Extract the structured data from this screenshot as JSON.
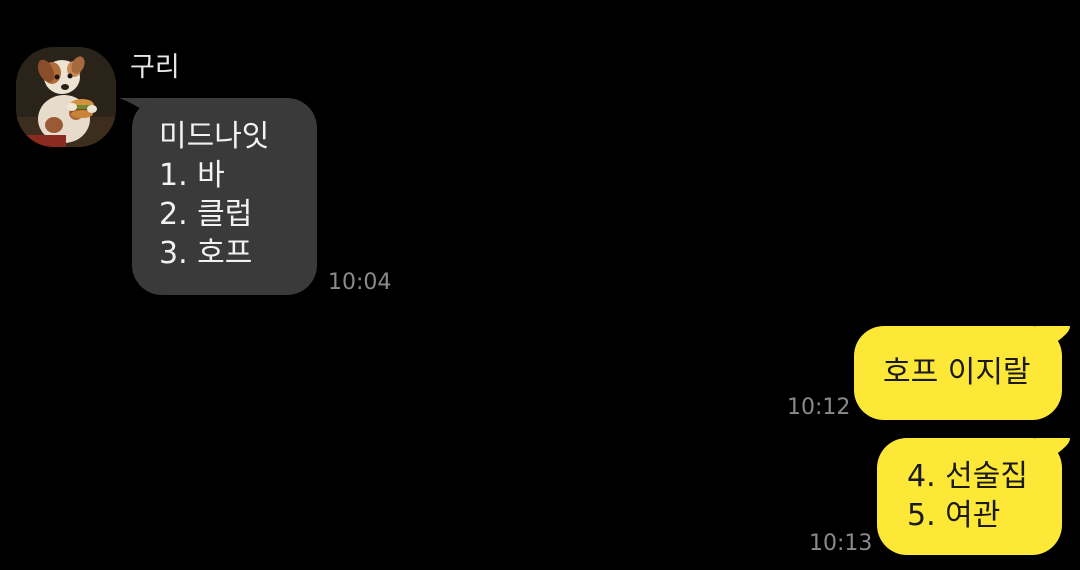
{
  "chat": {
    "incoming": {
      "sender": "구리",
      "avatar_icon": "dog-avatar",
      "bubble_color": "#3a3a3a",
      "lines": [
        "미드나잇",
        "1. 바",
        "2. 클럽",
        "3. 호프"
      ],
      "time": "10:04"
    },
    "outgoing": [
      {
        "lines": [
          "호프 이지랄"
        ],
        "time": "10:12"
      },
      {
        "lines": [
          "4. 선술집",
          "5. 여관"
        ],
        "time": "10:13"
      }
    ],
    "outgoing_bubble_color": "#fde838",
    "background_color": "#000000"
  }
}
